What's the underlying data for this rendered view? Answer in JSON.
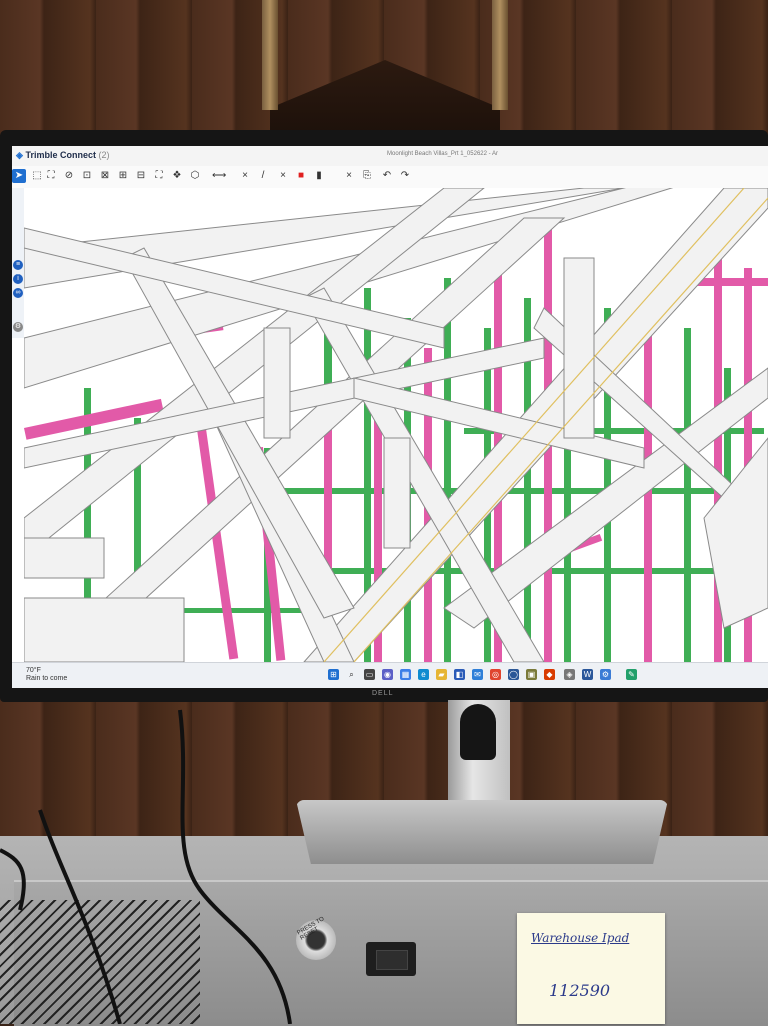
{
  "window": {
    "app_name": "Trimble Connect",
    "app_count": "(2)",
    "document_title": "Moonlight Beach Villas_Prt 1_052622 - Ar"
  },
  "toolbar": {
    "tools": [
      {
        "icon": "pointer-icon",
        "glyph": "➤",
        "active": true
      },
      {
        "icon": "box-select-icon",
        "glyph": "⬚"
      },
      {
        "icon": "multi-select-icon",
        "glyph": "⛶"
      },
      {
        "icon": "hide-icon",
        "glyph": "⊘"
      },
      {
        "icon": "clip-icon",
        "glyph": "⊡"
      },
      {
        "icon": "section-x-icon",
        "glyph": "⊠"
      },
      {
        "icon": "section-y-icon",
        "glyph": "⊞"
      },
      {
        "icon": "section-z-icon",
        "glyph": "⊟"
      },
      {
        "icon": "fit-icon",
        "glyph": "⛶"
      },
      {
        "icon": "explode-icon",
        "glyph": "❖"
      },
      {
        "icon": "cube-icon",
        "glyph": "⬡"
      },
      {
        "icon": "measure-icon",
        "glyph": "⟷"
      },
      {
        "icon": "close-icon",
        "glyph": "×"
      },
      {
        "icon": "pen-icon",
        "glyph": "/"
      },
      {
        "icon": "close-icon",
        "glyph": "×"
      },
      {
        "icon": "color-swatch-icon",
        "glyph": "■",
        "red": true
      },
      {
        "icon": "panel-icon",
        "glyph": "▮"
      },
      {
        "icon": "close-icon",
        "glyph": "×"
      },
      {
        "icon": "save-view-icon",
        "glyph": "⎘"
      },
      {
        "icon": "undo-icon",
        "glyph": "↶"
      },
      {
        "icon": "redo-icon",
        "glyph": "↷"
      }
    ]
  },
  "taskbar": {
    "weather_temp": "70°F",
    "weather_text": "Rain to come"
  },
  "monitor": {
    "brand": "DELL"
  },
  "sticky_note": {
    "line1": "Warehouse Ipad",
    "line2": "112590"
  },
  "knob_label": "PRESS TO RESET",
  "colors": {
    "framing_pink": "#e25aa8",
    "framing_green": "#3fae55",
    "truss_white": "#f2f2f2",
    "accent_blue": "#1f6fd0"
  }
}
